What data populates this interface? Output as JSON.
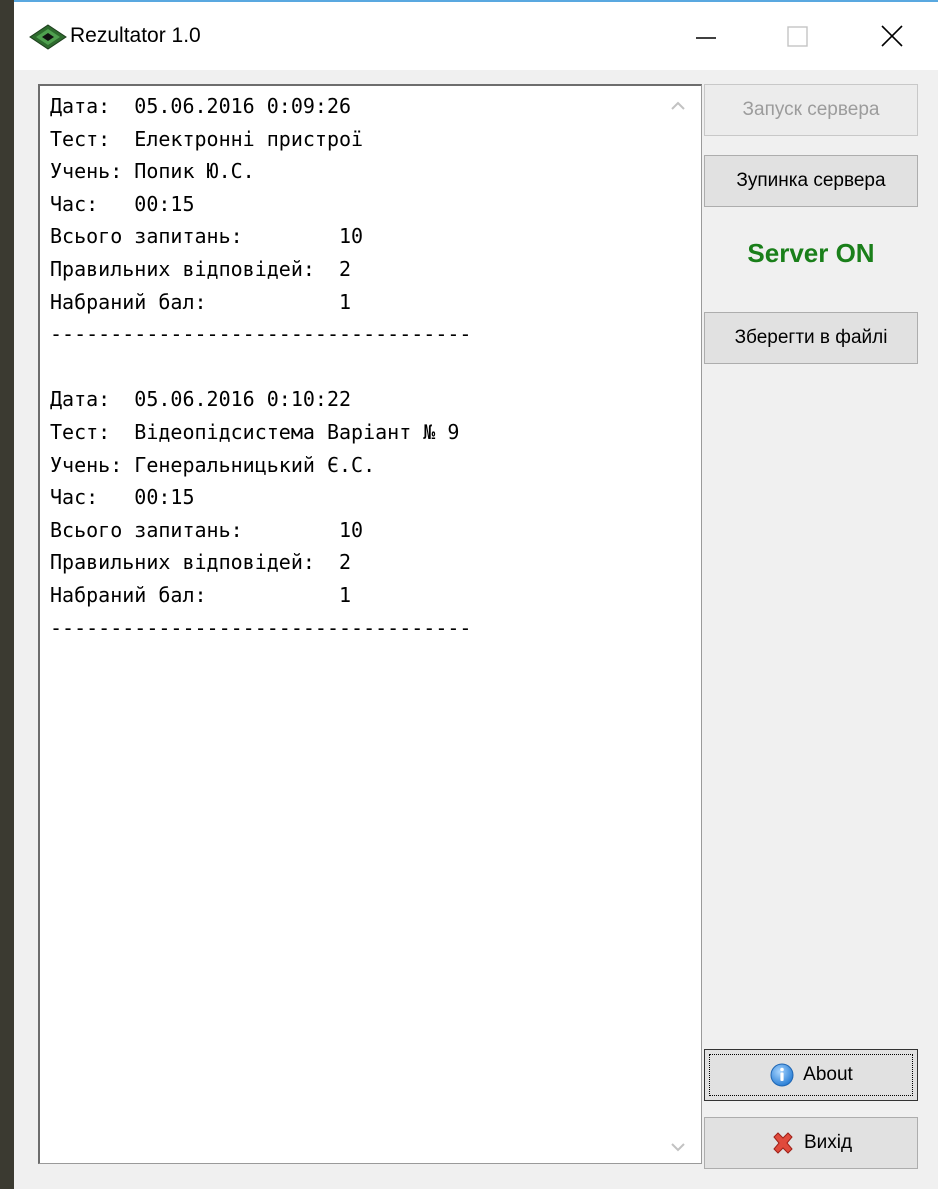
{
  "window": {
    "title": "Rezultator 1.0",
    "icon": "green-diamond-app-icon",
    "controls": [
      "minimize-icon",
      "maximize-icon",
      "close-icon"
    ]
  },
  "log_text": "Дата:  05.06.2016 0:09:26\nТест:  Електронні пристрої\nУчень: Попик Ю.С.\nЧас:   00:15\nВсього запитань:        10\nПравильних відповідей:  2\nНабраний бал:           1\n-----------------------------------\n\nДата:  05.06.2016 0:10:22\nТест:  Відеопідсистема Варіант № 9\nУчень: Генеральницький Є.С.\nЧас:   00:15\nВсього запитань:        10\nПравильних відповідей:  2\nНабраний бал:           1\n-----------------------------------",
  "buttons": {
    "start_server": "Запуск сервера",
    "stop_server": "Зупинка сервера",
    "save_to_file": "Зберегти в файлі",
    "about": "About",
    "exit": "Вихід"
  },
  "status": {
    "text": "Server ON",
    "color": "#1a7f1a"
  },
  "colors": {
    "title_accent": "#59a8e0",
    "disabled_text": "#9c9c9c"
  }
}
